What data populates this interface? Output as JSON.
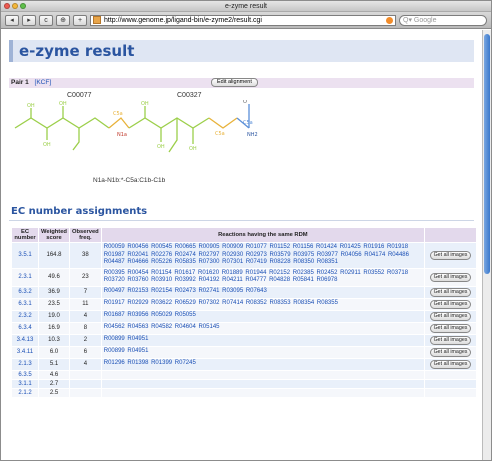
{
  "window": {
    "title": "e-zyme result",
    "colors": {
      "close": "#ee5a50",
      "minimize": "#f5b73a",
      "zoom": "#5fc04b"
    }
  },
  "toolbar": {
    "back": "◂",
    "forward": "▸",
    "reload": "c",
    "bookmark": "⊕",
    "add": "+",
    "url": "http://www.genome.jp/ligand-bin/e-zyme2/result.cgi",
    "search_placeholder": "Q▾ Google"
  },
  "page": {
    "title": "e-zyme result",
    "pair": {
      "label": "Pair 1",
      "kcf_link": "[KCF]",
      "edit_button": "Edit alignment"
    },
    "compounds": [
      "C00077",
      "C00327"
    ],
    "formula": "N1a-N1b:*-C5a:C1b-C1b",
    "section_title": "EC number assignments"
  },
  "table": {
    "headers": [
      "EC number",
      "Weighted score",
      "Observed freq.",
      "Reactions having the same RDM",
      ""
    ],
    "button_label": "Get all images",
    "rows": [
      {
        "ec": "3.5.1",
        "score": "164.8",
        "freq": "38",
        "reactions": "R00059 R00456 R00545 R00665 R00905 R00909 R01077 R01152 R01156 R01424 R01425 R01916 R01918 R01987 R02041 R02276 R02474 R02797 R02930 R02973 R03579 R03975 R03977 R04056 R04174 R04486 R04487 R04666 R05226 R05835 R07300 R07301 R07419 R08228 R08350 R08351",
        "button": true
      },
      {
        "ec": "2.3.1",
        "score": "49.6",
        "freq": "23",
        "reactions": "R00395 R00454 R01154 R01617 R01620 R01889 R01944 R02152 R02385 R02452 R02911 R03552 R03718 R03720 R03760 R03910 R03992 R04192 R04211 R04777 R04828 R05841 R06978",
        "button": true
      },
      {
        "ec": "6.3.2",
        "score": "36.9",
        "freq": "7",
        "reactions": "R00497 R02153 R02154 R02473 R02741 R03095 R07643",
        "button": true
      },
      {
        "ec": "6.3.1",
        "score": "23.5",
        "freq": "11",
        "reactions": "R01917 R02929 R03622 R06529 R07302 R07414 R08352 R08353 R08354 R08355",
        "button": true
      },
      {
        "ec": "2.3.2",
        "score": "19.0",
        "freq": "4",
        "reactions": "R01687 R03956 R05029 R05055",
        "button": true
      },
      {
        "ec": "6.3.4",
        "score": "16.9",
        "freq": "8",
        "reactions": "R04562 R04563 R04582 R04604 R05145",
        "button": true
      },
      {
        "ec": "3.4.13",
        "score": "10.3",
        "freq": "2",
        "reactions": "R00899 R04951",
        "button": true
      },
      {
        "ec": "3.4.11",
        "score": "6.0",
        "freq": "6",
        "reactions": "R00899 R04951",
        "button": true
      },
      {
        "ec": "2.1.3",
        "score": "5.1",
        "freq": "4",
        "reactions": "R01296 R01398 R01399 R07245",
        "button": true
      },
      {
        "ec": "6.3.5",
        "score": "4.6",
        "freq": "",
        "reactions": "",
        "button": false
      },
      {
        "ec": "3.1.1",
        "score": "2.7",
        "freq": "",
        "reactions": "",
        "button": false
      },
      {
        "ec": "2.1.2",
        "score": "2.5",
        "freq": "",
        "reactions": "",
        "button": false
      }
    ]
  }
}
